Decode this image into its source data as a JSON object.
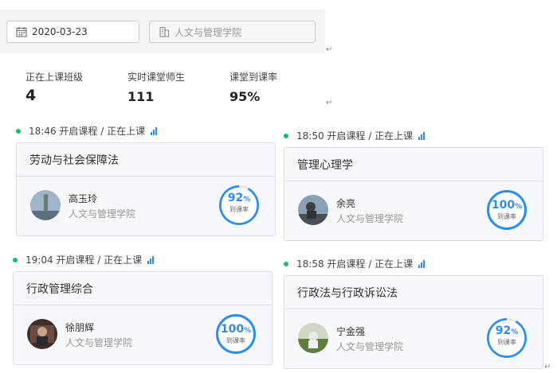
{
  "filters": {
    "date": "2020-03-23",
    "college_placeholder": "人文与管理学院"
  },
  "stats": [
    {
      "label": "正在上课班级",
      "value": "4"
    },
    {
      "label": "实时课堂师生",
      "value": "111"
    },
    {
      "label": "课堂到课率",
      "value": "95%"
    }
  ],
  "paragraph_mark": "↵",
  "colors": {
    "accent": "#2d8cf0",
    "live_dot": "#19be6b"
  },
  "classes": [
    {
      "time": "18:46 开启课程 / 正在上课",
      "course": "劳动与社会保障法",
      "teacher": "高玉玲",
      "dept": "人文与管理学院",
      "rate": "92",
      "rate_value": 0.92,
      "unit": "%",
      "rate_label": "到课率"
    },
    {
      "time": "18:50 开启课程 / 正在上课",
      "course": "管理心理学",
      "teacher": "余亮",
      "dept": "人文与管理学院",
      "rate": "100",
      "rate_value": 1.0,
      "unit": "%",
      "rate_label": "到课率"
    },
    {
      "time": "19:04 开启课程 / 正在上课",
      "course": "行政管理综合",
      "teacher": "徐朋辉",
      "dept": "人文与管理学院",
      "rate": "100",
      "rate_value": 1.0,
      "unit": "%",
      "rate_label": "到课率"
    },
    {
      "time": "18:58 开启课程 / 正在上课",
      "course": "行政法与行政诉讼法",
      "teacher": "宁金强",
      "dept": "人文与管理学院",
      "rate": "92",
      "rate_value": 0.92,
      "unit": "%",
      "rate_label": "到课率"
    }
  ]
}
